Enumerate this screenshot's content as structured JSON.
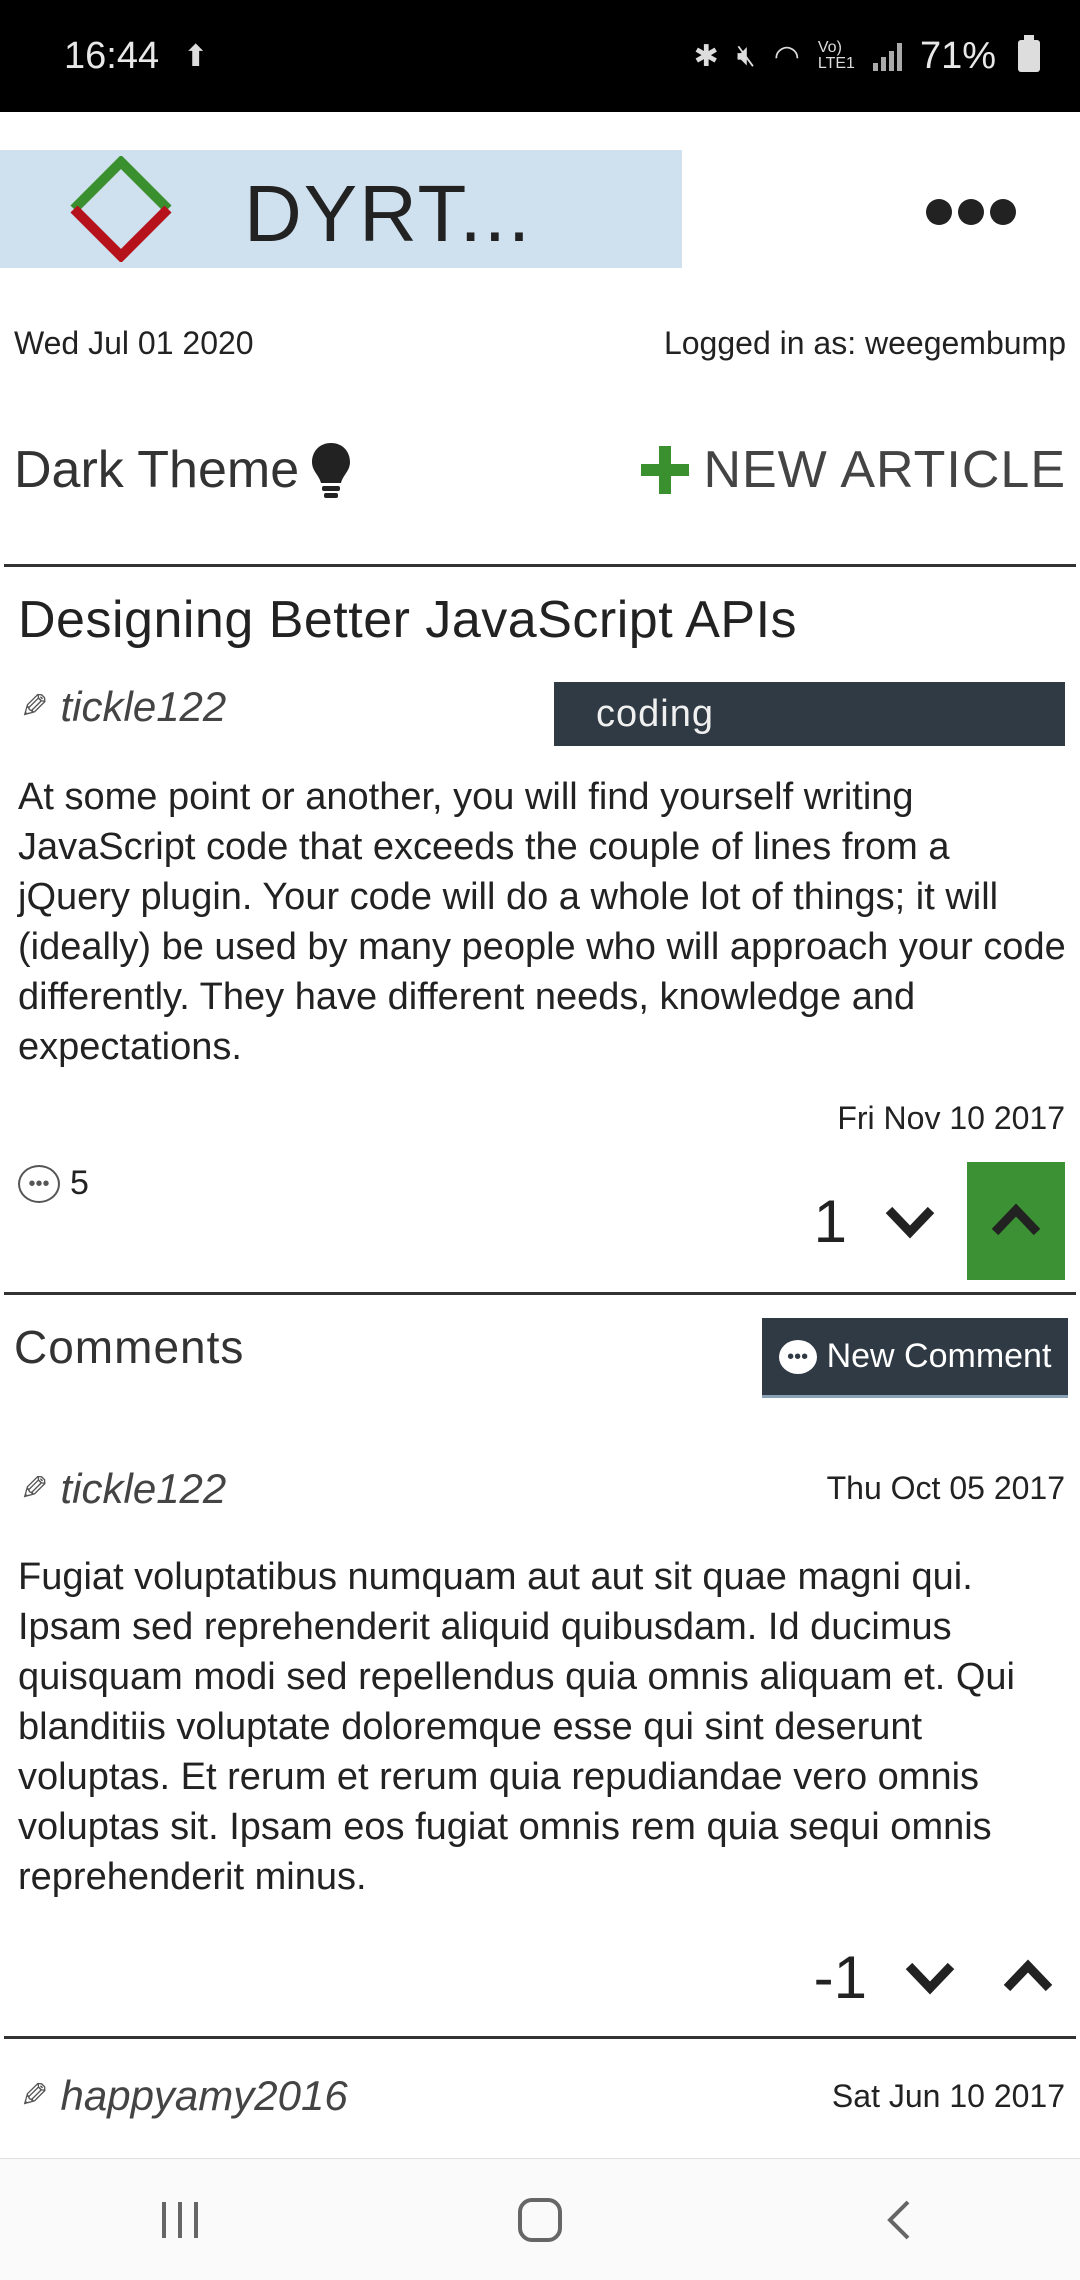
{
  "status_bar": {
    "time": "16:44",
    "battery": "71%",
    "icons": [
      "upload-icon",
      "bluetooth-icon",
      "mute-icon",
      "wifi-icon",
      "volte-icon",
      "signal-icon",
      "battery-icon"
    ]
  },
  "app": {
    "title": "DYRT...",
    "logo_colors": {
      "top": "#3a8f2e",
      "bottom": "#b5121b"
    },
    "accent": "#3b9133",
    "dark": "#2f3a44"
  },
  "meta": {
    "date": "Wed Jul 01 2020",
    "logged_in": "Logged in as: weegembump"
  },
  "controls": {
    "dark_theme": "Dark Theme",
    "new_article": "NEW ARTICLE"
  },
  "article": {
    "title": "Designing Better JavaScript APIs",
    "author": "tickle122",
    "tag": "coding",
    "body": "At some point or another, you will find yourself writing JavaScript code that exceeds the couple of lines from a jQuery plugin. Your code will do a whole lot of things; it will (ideally) be used by many people who will approach your code differently. They have different needs, knowledge and expectations.",
    "date": "Fri Nov 10 2017",
    "comment_count": "5",
    "votes": "1"
  },
  "comments_section": {
    "heading": "Comments",
    "new_comment": "New Comment",
    "items": [
      {
        "author": "tickle122",
        "date": "Thu Oct 05 2017",
        "body": "Fugiat voluptatibus numquam aut aut sit quae magni qui. Ipsam sed reprehenderit aliquid quibusdam. Id ducimus quisquam modi sed repellendus quia omnis aliquam et. Qui blanditiis voluptate doloremque esse qui sint deserunt voluptas. Et rerum et rerum quia repudiandae vero omnis voluptas sit. Ipsam eos fugiat omnis rem quia sequi omnis reprehenderit minus.",
        "votes": "-1"
      },
      {
        "author": "happyamy2016",
        "date": "Sat Jun 10 2017"
      }
    ]
  }
}
